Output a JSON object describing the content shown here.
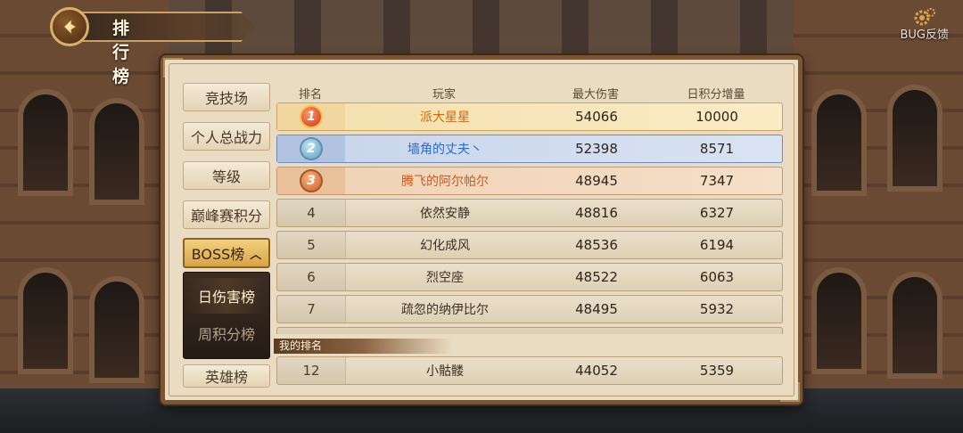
{
  "header": {
    "title": "排行榜",
    "bug_label": "BUG反馈"
  },
  "menu": {
    "items": [
      {
        "label": "竞技场"
      },
      {
        "label": "个人总战力"
      },
      {
        "label": "等级"
      },
      {
        "label": "巅峰赛积分"
      },
      {
        "label": "BOSS榜",
        "expanded": true
      },
      {
        "label": "英雄榜"
      }
    ],
    "boss_sub": [
      {
        "label": "日伤害榜",
        "selected": true
      },
      {
        "label": "周积分榜",
        "selected": false
      }
    ]
  },
  "table": {
    "columns": [
      "排名",
      "玩家",
      "最大伤害",
      "日积分增量"
    ],
    "rows": [
      {
        "rank": "1",
        "player": "派大星星",
        "max_damage": "54066",
        "daily_points": "10000"
      },
      {
        "rank": "2",
        "player": "墙角的丈夫丶",
        "max_damage": "52398",
        "daily_points": "8571"
      },
      {
        "rank": "3",
        "player": "腾飞的阿尔帕尔",
        "max_damage": "48945",
        "daily_points": "7347"
      },
      {
        "rank": "4",
        "player": "依然安静",
        "max_damage": "48816",
        "daily_points": "6327"
      },
      {
        "rank": "5",
        "player": "幻化成风",
        "max_damage": "48536",
        "daily_points": "6194"
      },
      {
        "rank": "6",
        "player": "烈空座",
        "max_damage": "48522",
        "daily_points": "6063"
      },
      {
        "rank": "7",
        "player": "疏忽的纳伊比尔",
        "max_damage": "48495",
        "daily_points": "5932"
      }
    ]
  },
  "my_rank": {
    "label": "我的排名",
    "rank": "12",
    "player": "小骷髅",
    "max_damage": "44052",
    "daily_points": "5359"
  },
  "colors": {
    "gold_accent": "#d7a447",
    "first_name": "#d06a10",
    "second_name": "#2f6bc7",
    "third_name": "#cc5a24"
  }
}
